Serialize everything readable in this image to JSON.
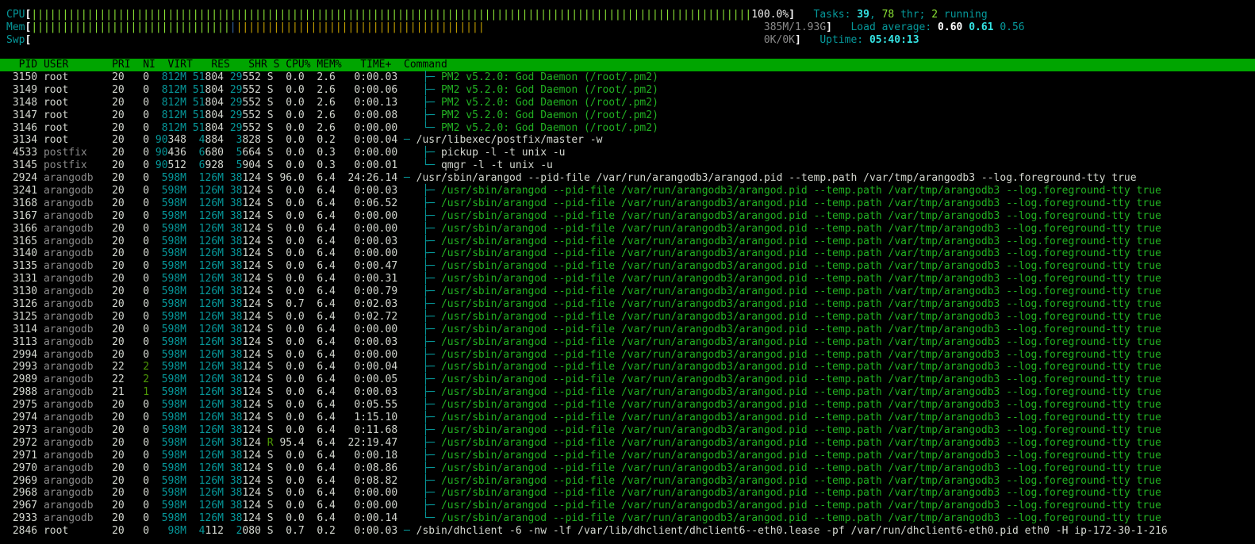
{
  "meters": {
    "cpu_label": "CPU",
    "cpu_value": "100.0%",
    "cpu_fraction": 1.0,
    "mem_label": "Mem",
    "mem_value": "385M/1.93G",
    "swp_label": "Swp",
    "swp_value": "0K/0K"
  },
  "summary": {
    "tasks_label": "Tasks: ",
    "tasks": "39",
    "threads": "78",
    "thr_label": " thr; ",
    "running": "2",
    "running_label": " running",
    "load_label": "Load average: ",
    "load1": "0.60",
    "load5": "0.61",
    "load15": "0.56",
    "uptime_label": "Uptime: ",
    "uptime": "05:40:13"
  },
  "header": {
    "pid": "PID",
    "user": "USER",
    "pri": "PRI",
    "ni": "NI",
    "virt": "VIRT",
    "res": "RES",
    "shr": "SHR",
    "s": "S",
    "cpu": "CPU%",
    "mem": "MEM%",
    "time": "TIME+",
    "command": "Command"
  },
  "colors": {
    "header_bg": "#00a500",
    "cyan": "#06989a",
    "green": "#4e9a06",
    "bright_green": "#8ae234"
  },
  "processes": [
    {
      "pid": "3150",
      "user": "root",
      "pri": "20",
      "ni": "0",
      "virt": "812M",
      "res": "51804",
      "shr": "29552",
      "s": "S",
      "cpu": "0.0",
      "mem": "2.6",
      "time": "0:00.03",
      "tree": "   ├─ ",
      "cmd": "PM2 v5.2.0: God Daemon (/root/.pm2)",
      "thread": true
    },
    {
      "pid": "3149",
      "user": "root",
      "pri": "20",
      "ni": "0",
      "virt": "812M",
      "res": "51804",
      "shr": "29552",
      "s": "S",
      "cpu": "0.0",
      "mem": "2.6",
      "time": "0:00.06",
      "tree": "   ├─ ",
      "cmd": "PM2 v5.2.0: God Daemon (/root/.pm2)",
      "thread": true
    },
    {
      "pid": "3148",
      "user": "root",
      "pri": "20",
      "ni": "0",
      "virt": "812M",
      "res": "51804",
      "shr": "29552",
      "s": "S",
      "cpu": "0.0",
      "mem": "2.6",
      "time": "0:00.13",
      "tree": "   ├─ ",
      "cmd": "PM2 v5.2.0: God Daemon (/root/.pm2)",
      "thread": true
    },
    {
      "pid": "3147",
      "user": "root",
      "pri": "20",
      "ni": "0",
      "virt": "812M",
      "res": "51804",
      "shr": "29552",
      "s": "S",
      "cpu": "0.0",
      "mem": "2.6",
      "time": "0:00.08",
      "tree": "   ├─ ",
      "cmd": "PM2 v5.2.0: God Daemon (/root/.pm2)",
      "thread": true
    },
    {
      "pid": "3146",
      "user": "root",
      "pri": "20",
      "ni": "0",
      "virt": "812M",
      "res": "51804",
      "shr": "29552",
      "s": "S",
      "cpu": "0.0",
      "mem": "2.6",
      "time": "0:00.00",
      "tree": "   └─ ",
      "cmd": "PM2 v5.2.0: God Daemon (/root/.pm2)",
      "thread": true
    },
    {
      "pid": "3134",
      "user": "root",
      "pri": "20",
      "ni": "0",
      "virt": "90348",
      "res": "4884",
      "shr": "3828",
      "s": "S",
      "cpu": "0.0",
      "mem": "0.2",
      "time": "0:00.04",
      "tree": "─ ",
      "cmd": "/usr/libexec/postfix/master -w",
      "thread": false
    },
    {
      "pid": "4533",
      "user": "postfix",
      "pri": "20",
      "ni": "0",
      "virt": "90436",
      "res": "6680",
      "shr": "5664",
      "s": "S",
      "cpu": "0.0",
      "mem": "0.3",
      "time": "0:00.00",
      "tree": "   ├─ ",
      "cmd": "pickup -l -t unix -u",
      "thread": false
    },
    {
      "pid": "3145",
      "user": "postfix",
      "pri": "20",
      "ni": "0",
      "virt": "90512",
      "res": "6928",
      "shr": "5904",
      "s": "S",
      "cpu": "0.0",
      "mem": "0.3",
      "time": "0:00.01",
      "tree": "   └─ ",
      "cmd": "qmgr -l -t unix -u",
      "thread": false
    },
    {
      "pid": "2924",
      "user": "arangodb",
      "pri": "20",
      "ni": "0",
      "virt": "598M",
      "res": "126M",
      "shr": "38124",
      "s": "S",
      "cpu": "96.0",
      "mem": "6.4",
      "time": "24:26.14",
      "tree": "─ ",
      "cmd": "/usr/sbin/arangod --pid-file /var/run/arangodb3/arangod.pid --temp.path /var/tmp/arangodb3 --log.foreground-tty true",
      "thread": false
    },
    {
      "pid": "3241",
      "user": "arangodb",
      "pri": "20",
      "ni": "0",
      "virt": "598M",
      "res": "126M",
      "shr": "38124",
      "s": "S",
      "cpu": "0.0",
      "mem": "6.4",
      "time": "0:00.03",
      "tree": "   ├─ ",
      "cmd": "/usr/sbin/arangod --pid-file /var/run/arangodb3/arangod.pid --temp.path /var/tmp/arangodb3 --log.foreground-tty true",
      "thread": true
    },
    {
      "pid": "3168",
      "user": "arangodb",
      "pri": "20",
      "ni": "0",
      "virt": "598M",
      "res": "126M",
      "shr": "38124",
      "s": "S",
      "cpu": "0.0",
      "mem": "6.4",
      "time": "0:06.52",
      "tree": "   ├─ ",
      "cmd": "/usr/sbin/arangod --pid-file /var/run/arangodb3/arangod.pid --temp.path /var/tmp/arangodb3 --log.foreground-tty true",
      "thread": true
    },
    {
      "pid": "3167",
      "user": "arangodb",
      "pri": "20",
      "ni": "0",
      "virt": "598M",
      "res": "126M",
      "shr": "38124",
      "s": "S",
      "cpu": "0.0",
      "mem": "6.4",
      "time": "0:00.00",
      "tree": "   ├─ ",
      "cmd": "/usr/sbin/arangod --pid-file /var/run/arangodb3/arangod.pid --temp.path /var/tmp/arangodb3 --log.foreground-tty true",
      "thread": true
    },
    {
      "pid": "3166",
      "user": "arangodb",
      "pri": "20",
      "ni": "0",
      "virt": "598M",
      "res": "126M",
      "shr": "38124",
      "s": "S",
      "cpu": "0.0",
      "mem": "6.4",
      "time": "0:00.00",
      "tree": "   ├─ ",
      "cmd": "/usr/sbin/arangod --pid-file /var/run/arangodb3/arangod.pid --temp.path /var/tmp/arangodb3 --log.foreground-tty true",
      "thread": true
    },
    {
      "pid": "3165",
      "user": "arangodb",
      "pri": "20",
      "ni": "0",
      "virt": "598M",
      "res": "126M",
      "shr": "38124",
      "s": "S",
      "cpu": "0.0",
      "mem": "6.4",
      "time": "0:00.03",
      "tree": "   ├─ ",
      "cmd": "/usr/sbin/arangod --pid-file /var/run/arangodb3/arangod.pid --temp.path /var/tmp/arangodb3 --log.foreground-tty true",
      "thread": true
    },
    {
      "pid": "3140",
      "user": "arangodb",
      "pri": "20",
      "ni": "0",
      "virt": "598M",
      "res": "126M",
      "shr": "38124",
      "s": "S",
      "cpu": "0.0",
      "mem": "6.4",
      "time": "0:00.00",
      "tree": "   ├─ ",
      "cmd": "/usr/sbin/arangod --pid-file /var/run/arangodb3/arangod.pid --temp.path /var/tmp/arangodb3 --log.foreground-tty true",
      "thread": true
    },
    {
      "pid": "3135",
      "user": "arangodb",
      "pri": "20",
      "ni": "0",
      "virt": "598M",
      "res": "126M",
      "shr": "38124",
      "s": "S",
      "cpu": "0.0",
      "mem": "6.4",
      "time": "0:00.47",
      "tree": "   ├─ ",
      "cmd": "/usr/sbin/arangod --pid-file /var/run/arangodb3/arangod.pid --temp.path /var/tmp/arangodb3 --log.foreground-tty true",
      "thread": true
    },
    {
      "pid": "3131",
      "user": "arangodb",
      "pri": "20",
      "ni": "0",
      "virt": "598M",
      "res": "126M",
      "shr": "38124",
      "s": "S",
      "cpu": "0.0",
      "mem": "6.4",
      "time": "0:00.31",
      "tree": "   ├─ ",
      "cmd": "/usr/sbin/arangod --pid-file /var/run/arangodb3/arangod.pid --temp.path /var/tmp/arangodb3 --log.foreground-tty true",
      "thread": true
    },
    {
      "pid": "3130",
      "user": "arangodb",
      "pri": "20",
      "ni": "0",
      "virt": "598M",
      "res": "126M",
      "shr": "38124",
      "s": "S",
      "cpu": "0.0",
      "mem": "6.4",
      "time": "0:00.79",
      "tree": "   ├─ ",
      "cmd": "/usr/sbin/arangod --pid-file /var/run/arangodb3/arangod.pid --temp.path /var/tmp/arangodb3 --log.foreground-tty true",
      "thread": true
    },
    {
      "pid": "3126",
      "user": "arangodb",
      "pri": "20",
      "ni": "0",
      "virt": "598M",
      "res": "126M",
      "shr": "38124",
      "s": "S",
      "cpu": "0.7",
      "mem": "6.4",
      "time": "0:02.03",
      "tree": "   ├─ ",
      "cmd": "/usr/sbin/arangod --pid-file /var/run/arangodb3/arangod.pid --temp.path /var/tmp/arangodb3 --log.foreground-tty true",
      "thread": true
    },
    {
      "pid": "3125",
      "user": "arangodb",
      "pri": "20",
      "ni": "0",
      "virt": "598M",
      "res": "126M",
      "shr": "38124",
      "s": "S",
      "cpu": "0.0",
      "mem": "6.4",
      "time": "0:02.72",
      "tree": "   ├─ ",
      "cmd": "/usr/sbin/arangod --pid-file /var/run/arangodb3/arangod.pid --temp.path /var/tmp/arangodb3 --log.foreground-tty true",
      "thread": true
    },
    {
      "pid": "3114",
      "user": "arangodb",
      "pri": "20",
      "ni": "0",
      "virt": "598M",
      "res": "126M",
      "shr": "38124",
      "s": "S",
      "cpu": "0.0",
      "mem": "6.4",
      "time": "0:00.00",
      "tree": "   ├─ ",
      "cmd": "/usr/sbin/arangod --pid-file /var/run/arangodb3/arangod.pid --temp.path /var/tmp/arangodb3 --log.foreground-tty true",
      "thread": true
    },
    {
      "pid": "3113",
      "user": "arangodb",
      "pri": "20",
      "ni": "0",
      "virt": "598M",
      "res": "126M",
      "shr": "38124",
      "s": "S",
      "cpu": "0.0",
      "mem": "6.4",
      "time": "0:00.03",
      "tree": "   ├─ ",
      "cmd": "/usr/sbin/arangod --pid-file /var/run/arangodb3/arangod.pid --temp.path /var/tmp/arangodb3 --log.foreground-tty true",
      "thread": true
    },
    {
      "pid": "2994",
      "user": "arangodb",
      "pri": "20",
      "ni": "0",
      "virt": "598M",
      "res": "126M",
      "shr": "38124",
      "s": "S",
      "cpu": "0.0",
      "mem": "6.4",
      "time": "0:00.00",
      "tree": "   ├─ ",
      "cmd": "/usr/sbin/arangod --pid-file /var/run/arangodb3/arangod.pid --temp.path /var/tmp/arangodb3 --log.foreground-tty true",
      "thread": true
    },
    {
      "pid": "2993",
      "user": "arangodb",
      "pri": "22",
      "ni": "2",
      "virt": "598M",
      "res": "126M",
      "shr": "38124",
      "s": "S",
      "cpu": "0.0",
      "mem": "6.4",
      "time": "0:00.04",
      "tree": "   ├─ ",
      "cmd": "/usr/sbin/arangod --pid-file /var/run/arangodb3/arangod.pid --temp.path /var/tmp/arangodb3 --log.foreground-tty true",
      "thread": true
    },
    {
      "pid": "2989",
      "user": "arangodb",
      "pri": "22",
      "ni": "2",
      "virt": "598M",
      "res": "126M",
      "shr": "38124",
      "s": "S",
      "cpu": "0.0",
      "mem": "6.4",
      "time": "0:00.05",
      "tree": "   ├─ ",
      "cmd": "/usr/sbin/arangod --pid-file /var/run/arangodb3/arangod.pid --temp.path /var/tmp/arangodb3 --log.foreground-tty true",
      "thread": true
    },
    {
      "pid": "2988",
      "user": "arangodb",
      "pri": "21",
      "ni": "1",
      "virt": "598M",
      "res": "126M",
      "shr": "38124",
      "s": "S",
      "cpu": "0.0",
      "mem": "6.4",
      "time": "0:00.03",
      "tree": "   ├─ ",
      "cmd": "/usr/sbin/arangod --pid-file /var/run/arangodb3/arangod.pid --temp.path /var/tmp/arangodb3 --log.foreground-tty true",
      "thread": true
    },
    {
      "pid": "2975",
      "user": "arangodb",
      "pri": "20",
      "ni": "0",
      "virt": "598M",
      "res": "126M",
      "shr": "38124",
      "s": "S",
      "cpu": "0.0",
      "mem": "6.4",
      "time": "0:05.55",
      "tree": "   ├─ ",
      "cmd": "/usr/sbin/arangod --pid-file /var/run/arangodb3/arangod.pid --temp.path /var/tmp/arangodb3 --log.foreground-tty true",
      "thread": true
    },
    {
      "pid": "2974",
      "user": "arangodb",
      "pri": "20",
      "ni": "0",
      "virt": "598M",
      "res": "126M",
      "shr": "38124",
      "s": "S",
      "cpu": "0.0",
      "mem": "6.4",
      "time": "1:15.10",
      "tree": "   ├─ ",
      "cmd": "/usr/sbin/arangod --pid-file /var/run/arangodb3/arangod.pid --temp.path /var/tmp/arangodb3 --log.foreground-tty true",
      "thread": true
    },
    {
      "pid": "2973",
      "user": "arangodb",
      "pri": "20",
      "ni": "0",
      "virt": "598M",
      "res": "126M",
      "shr": "38124",
      "s": "S",
      "cpu": "0.0",
      "mem": "6.4",
      "time": "0:11.68",
      "tree": "   ├─ ",
      "cmd": "/usr/sbin/arangod --pid-file /var/run/arangodb3/arangod.pid --temp.path /var/tmp/arangodb3 --log.foreground-tty true",
      "thread": true
    },
    {
      "pid": "2972",
      "user": "arangodb",
      "pri": "20",
      "ni": "0",
      "virt": "598M",
      "res": "126M",
      "shr": "38124",
      "s": "R",
      "cpu": "95.4",
      "mem": "6.4",
      "time": "22:19.47",
      "tree": "   ├─ ",
      "cmd": "/usr/sbin/arangod --pid-file /var/run/arangodb3/arangod.pid --temp.path /var/tmp/arangodb3 --log.foreground-tty true",
      "thread": true
    },
    {
      "pid": "2971",
      "user": "arangodb",
      "pri": "20",
      "ni": "0",
      "virt": "598M",
      "res": "126M",
      "shr": "38124",
      "s": "S",
      "cpu": "0.0",
      "mem": "6.4",
      "time": "0:00.18",
      "tree": "   ├─ ",
      "cmd": "/usr/sbin/arangod --pid-file /var/run/arangodb3/arangod.pid --temp.path /var/tmp/arangodb3 --log.foreground-tty true",
      "thread": true
    },
    {
      "pid": "2970",
      "user": "arangodb",
      "pri": "20",
      "ni": "0",
      "virt": "598M",
      "res": "126M",
      "shr": "38124",
      "s": "S",
      "cpu": "0.0",
      "mem": "6.4",
      "time": "0:08.86",
      "tree": "   ├─ ",
      "cmd": "/usr/sbin/arangod --pid-file /var/run/arangodb3/arangod.pid --temp.path /var/tmp/arangodb3 --log.foreground-tty true",
      "thread": true
    },
    {
      "pid": "2969",
      "user": "arangodb",
      "pri": "20",
      "ni": "0",
      "virt": "598M",
      "res": "126M",
      "shr": "38124",
      "s": "S",
      "cpu": "0.0",
      "mem": "6.4",
      "time": "0:08.82",
      "tree": "   ├─ ",
      "cmd": "/usr/sbin/arangod --pid-file /var/run/arangodb3/arangod.pid --temp.path /var/tmp/arangodb3 --log.foreground-tty true",
      "thread": true
    },
    {
      "pid": "2968",
      "user": "arangodb",
      "pri": "20",
      "ni": "0",
      "virt": "598M",
      "res": "126M",
      "shr": "38124",
      "s": "S",
      "cpu": "0.0",
      "mem": "6.4",
      "time": "0:00.00",
      "tree": "   ├─ ",
      "cmd": "/usr/sbin/arangod --pid-file /var/run/arangodb3/arangod.pid --temp.path /var/tmp/arangodb3 --log.foreground-tty true",
      "thread": true
    },
    {
      "pid": "2967",
      "user": "arangodb",
      "pri": "20",
      "ni": "0",
      "virt": "598M",
      "res": "126M",
      "shr": "38124",
      "s": "S",
      "cpu": "0.0",
      "mem": "6.4",
      "time": "0:00.00",
      "tree": "   ├─ ",
      "cmd": "/usr/sbin/arangod --pid-file /var/run/arangodb3/arangod.pid --temp.path /var/tmp/arangodb3 --log.foreground-tty true",
      "thread": true
    },
    {
      "pid": "2933",
      "user": "arangodb",
      "pri": "20",
      "ni": "0",
      "virt": "598M",
      "res": "126M",
      "shr": "38124",
      "s": "S",
      "cpu": "0.0",
      "mem": "6.4",
      "time": "0:00.14",
      "tree": "   └─ ",
      "cmd": "/usr/sbin/arangod --pid-file /var/run/arangodb3/arangod.pid --temp.path /var/tmp/arangodb3 --log.foreground-tty true",
      "thread": true
    },
    {
      "pid": "2846",
      "user": "root",
      "pri": "20",
      "ni": "0",
      "virt": "98M",
      "res": "4112",
      "shr": "2080",
      "s": "S",
      "cpu": "0.7",
      "mem": "0.2",
      "time": "0:00.03",
      "tree": "─ ",
      "cmd": "/sbin/dhclient -6 -nw -lf /var/lib/dhclient/dhclient6--eth0.lease -pf /var/run/dhclient6-eth0.pid eth0 -H ip-172-30-1-216",
      "thread": false
    }
  ]
}
